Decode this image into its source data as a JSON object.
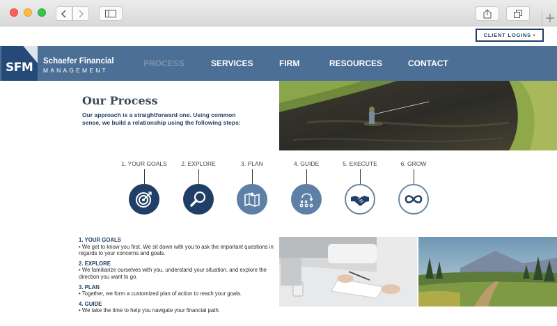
{
  "browser": {
    "buttons": [
      "back",
      "forward",
      "sidebar",
      "share",
      "tabs",
      "new-tab"
    ]
  },
  "utility": {
    "client_logins": "CLIENT LOGINS •"
  },
  "logo": {
    "mark": "SFM"
  },
  "brand": {
    "name": "Schaefer Financial",
    "sub": "MANAGEMENT"
  },
  "nav": {
    "items": [
      {
        "label": "PROCESS",
        "active": true
      },
      {
        "label": "SERVICES"
      },
      {
        "label": "FIRM"
      },
      {
        "label": "RESOURCES"
      },
      {
        "label": "CONTACT"
      }
    ]
  },
  "main": {
    "title": "Our Process",
    "intro": "Our approach is a straightforward one. Using common sense, we build a relationship using the following steps:"
  },
  "steps": [
    {
      "label": "1. YOUR GOALS",
      "icon": "target-icon"
    },
    {
      "label": "2. EXPLORE",
      "icon": "magnifier-icon"
    },
    {
      "label": "3. PLAN",
      "icon": "map-icon"
    },
    {
      "label": "4. GUIDE",
      "icon": "playbook-icon"
    },
    {
      "label": "5. EXECUTE",
      "icon": "handshake-icon"
    },
    {
      "label": "6. GROW",
      "icon": "infinity-icon"
    }
  ],
  "details": [
    {
      "heading": "1. YOUR GOALS",
      "text": "• We get to know you first. We sit down with you to ask the important questions in regards to your concerns and goals."
    },
    {
      "heading": "2. EXPLORE",
      "text": "• We familiarize ourselves with you, understand your situation, and explore the direction you want to go."
    },
    {
      "heading": "3. PLAN",
      "text": "• Together, we form a customized plan of action to reach your goals."
    },
    {
      "heading": "4. GUIDE",
      "text": "• We take the time to help you navigate your financial path."
    }
  ],
  "colors": {
    "navy": "#1f3f66",
    "nav_bg": "#4b6f95",
    "mid_blue": "#5e7fa6"
  }
}
